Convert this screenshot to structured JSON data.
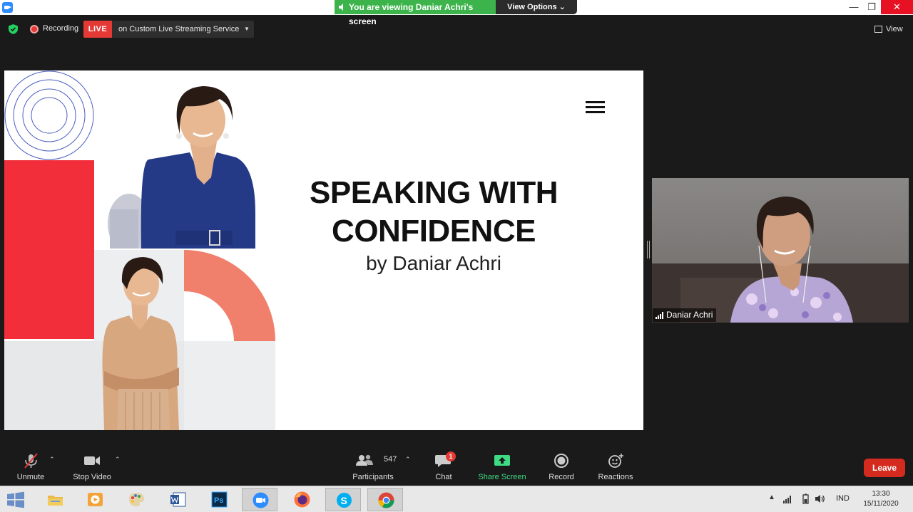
{
  "titlebar": {
    "viewing_banner": "You are viewing Daniar Achri's screen",
    "view_options": "View Options ⌄"
  },
  "topbar": {
    "recording_label": "Recording",
    "live_label": "LIVE",
    "stream_service": "on Custom Live Streaming Service",
    "view_label": "View"
  },
  "slide": {
    "title_line1": "SPEAKING WITH",
    "title_line2": "CONFIDENCE",
    "subtitle": "by Daniar Achri"
  },
  "participant": {
    "name": "Daniar Achri"
  },
  "toolbar": {
    "unmute_label": "Unmute",
    "stop_video_label": "Stop Video",
    "participants_label": "Participants",
    "participants_count": "547",
    "chat_label": "Chat",
    "chat_unread": "1",
    "share_screen_label": "Share Screen",
    "record_label": "Record",
    "reactions_label": "Reactions",
    "leave_label": "Leave"
  },
  "taskbar": {
    "apps": [
      "file-explorer",
      "media-player",
      "paint",
      "microsoft-word",
      "photoshop",
      "zoom",
      "firefox",
      "skype",
      "chrome"
    ],
    "language": "IND",
    "time": "13:30",
    "date": "15/11/2020"
  },
  "colors": {
    "live_red": "#e53935",
    "share_green": "#3ddc84",
    "banner_green": "#3cb44b",
    "slide_red": "#f22e3a",
    "slide_orange": "#f07f6c",
    "leave_red": "#d52b1e"
  }
}
